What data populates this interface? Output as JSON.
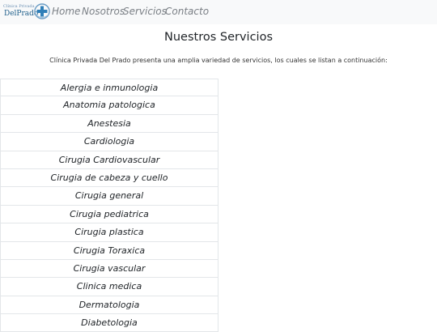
{
  "brand": {
    "small_text": "Clínica Privada",
    "name": "DelPrado"
  },
  "nav": {
    "home": "Home",
    "about": "Nosotros",
    "services": "Servicios",
    "contact": "Contacto"
  },
  "main": {
    "title": "Nuestros Servicios",
    "intro": "Clínica Privada Del Prado presenta una amplia variedad de servicios, los cuales se listan a continuación:"
  },
  "services": [
    "Alergia e inmunologia",
    "Anatomia patologica",
    "Anestesia",
    "Cardiologia",
    "Cirugia Cardiovascular",
    "Cirugia de cabeza y cuello",
    "Cirugia general",
    "Cirugia pediatrica",
    "Cirugia plastica",
    "Cirugia Toraxica",
    "Cirugia vascular",
    "Clinica medica",
    "Dermatologia",
    "Diabetologia"
  ],
  "colors": {
    "navbar_bg": "#f8f9fa",
    "nav_link": "#7a7f85",
    "brand_blue": "#1f5f8b"
  }
}
